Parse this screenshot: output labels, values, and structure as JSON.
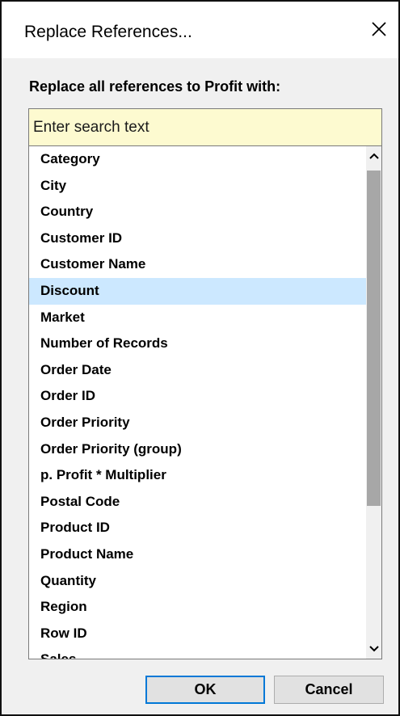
{
  "window": {
    "title": "Replace References..."
  },
  "prompt": "Replace all references to Profit with:",
  "search": {
    "placeholder": "Enter search text",
    "value": ""
  },
  "fields": [
    "Category",
    "City",
    "Country",
    "Customer ID",
    "Customer Name",
    "Discount",
    "Market",
    "Number of Records",
    "Order Date",
    "Order ID",
    "Order Priority",
    "Order Priority (group)",
    "p. Profit * Multiplier",
    "Postal Code",
    "Product ID",
    "Product Name",
    "Quantity",
    "Region",
    "Row ID",
    "Sales"
  ],
  "selected_field": "Discount",
  "buttons": {
    "ok": "OK",
    "cancel": "Cancel"
  },
  "icons": {
    "close": "close-icon",
    "scroll_up": "chevron-up-icon",
    "scroll_down": "chevron-down-icon"
  },
  "colors": {
    "selection": "#cce8ff",
    "search_background": "#fdfad0",
    "ok_border": "#0078d7",
    "scrollbar_thumb": "#a7a7a7"
  }
}
